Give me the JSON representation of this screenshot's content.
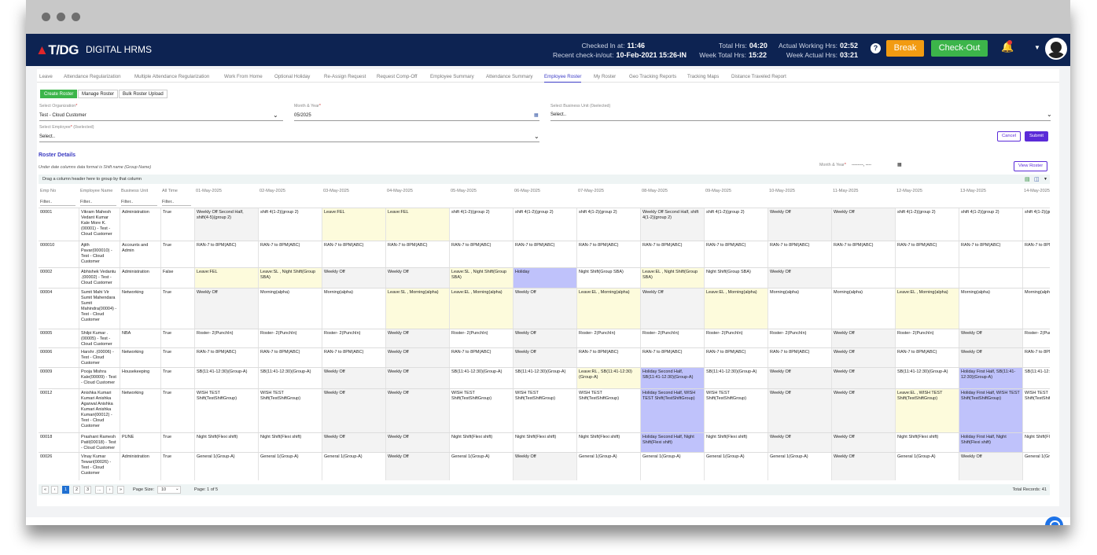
{
  "app": {
    "logo": "T/DG",
    "name": "DIGITAL HRMS"
  },
  "header": {
    "checked_in_label": "Checked In at:",
    "checked_in": "11:46",
    "recent_label": "Recent check-in/out:",
    "recent": "10-Feb-2021 15:26-IN",
    "total_hrs_label": "Total Hrs:",
    "total_hrs": "04:20",
    "week_total_label": "Week Total Hrs:",
    "week_total": "15:22",
    "actual_label": "Actual Working Hrs:",
    "actual": "02:52",
    "week_actual_label": "Week Actual Hrs:",
    "week_actual": "03:21",
    "break_btn": "Break",
    "checkout_btn": "Check-Out",
    "help": "?"
  },
  "tabs": [
    "Leave",
    "Attendance Regularization",
    "Multiple Attendance Regularization",
    "Work From Home",
    "Optional Holiday",
    "Re-Assign Request",
    "Request Comp-Off",
    "Employee Summary",
    "Attendance Summary",
    "Employee Roster",
    "My Roster",
    "Geo Tracking Reports",
    "Tracking Maps",
    "Distance Traveled Report"
  ],
  "active_tab": "Employee Roster",
  "sub_buttons": [
    "Create Roster",
    "Manage Roster",
    "Bulk Roster Upload"
  ],
  "form": {
    "org_label": "Select Organization",
    "org_value": "Test - Cloud Customer",
    "month_label": "Month & Year",
    "month_value": "05/2025",
    "bu_label": "Select Business Unit",
    "bu_sel": "(0selected)",
    "bu_value": "Select..",
    "emp_label": "Select Employee",
    "emp_sel": "(0selected)",
    "emp_value": "Select..",
    "cancel": "Cancel",
    "submit": "Submit"
  },
  "roster": {
    "title": "Roster Details",
    "note": "Under date columns data format is Shift name (Group Name)",
    "month_label": "Month & Year",
    "month_value": "--------, ----",
    "view_btn": "View Roster",
    "group_hint": "Drag a column header here to group by that column",
    "filter": "Filter..",
    "columns": [
      "Emp No",
      "Employee Name",
      "Business Unit",
      "All Time",
      "01-May-2025",
      "02-May-2025",
      "03-May-2025",
      "04-May-2025",
      "05-May-2025",
      "06-May-2025",
      "07-May-2025",
      "08-May-2025",
      "09-May-2025",
      "10-May-2025",
      "11-May-2025",
      "12-May-2025",
      "13-May-2025",
      "14-May-2025"
    ],
    "rows": [
      {
        "no": "00001",
        "name": "Vikram Mahesh Vedant Kumar Kale More K.(00001) - Test - Cloud Customer",
        "bu": "Administration",
        "all": "True",
        "cells": [
          "Weekly Off Second Half, shift(4-5)(group 2)",
          "shift 4(1-2)(group 2)",
          "Leave:FEL",
          "Leave:FEL",
          "shift 4(1-2)(group 2)",
          "shift 4(1-2)(group 2)",
          "shift 4(1-2)(group 2)",
          "Weekly Off Second Half, shift 4(1-2)(group 2)",
          "shift 4(1-2)(group 2)",
          "Weekly Off",
          "Weekly Off",
          "shift 4(1-2)(group 2)",
          "shift 4(1-2)(group 2)",
          "shift 4(1-2)(group 2)"
        ],
        "bg": [
          "g",
          "w",
          "y",
          "y",
          "w",
          "w",
          "w",
          "g",
          "w",
          "g",
          "g",
          "w",
          "w",
          "w"
        ]
      },
      {
        "no": "000010",
        "name": "Ajith Pavar(000010) - Test - Cloud Customer",
        "bu": "Accounts and Admin",
        "all": "True",
        "cells": [
          "RAN-7 to 8PM(ABC)",
          "RAN-7 to 8PM(ABC)",
          "RAN-7 to 8PM(ABC)",
          "RAN-7 to 8PM(ABC)",
          "RAN-7 to 8PM(ABC)",
          "RAN-7 to 8PM(ABC)",
          "RAN-7 to 8PM(ABC)",
          "RAN-7 to 8PM(ABC)",
          "RAN-7 to 8PM(ABC)",
          "RAN-7 to 8PM(ABC)",
          "RAN-7 to 8PM(ABC)",
          "RAN-7 to 8PM(ABC)",
          "RAN-7 to 8PM(ABC)",
          "RAN-7 to 8PM(ABC)"
        ],
        "bg": [
          "w",
          "w",
          "w",
          "w",
          "w",
          "w",
          "w",
          "w",
          "w",
          "w",
          "w",
          "w",
          "w",
          "w"
        ]
      },
      {
        "no": "00002",
        "name": "Abhishek Vedantu .(00002) - Test - Cloud Customer",
        "bu": "Administration",
        "all": "False",
        "cells": [
          "Leave:FEL",
          "Leave:SL , Night Shift(Group SBA)",
          "Weekly Off",
          "Weekly Off",
          "Leave:SL , Night Shift(Group SBA)",
          "Holiday",
          "Night Shift(Group SBA)",
          "Leave:EL , Night Shift(Group SBA)",
          "Night Shift(Group SBA)",
          "Weekly Off",
          "",
          "",
          "",
          ""
        ],
        "bg": [
          "y",
          "y",
          "g",
          "g",
          "y",
          "p",
          "w",
          "y",
          "w",
          "g",
          "w",
          "w",
          "w",
          "w"
        ]
      },
      {
        "no": "00004",
        "name": "Sumit Mahi Vir Sumit Mahendara Sumit Mahindra(00004) - Test - Cloud Customer",
        "bu": "Networking",
        "all": "True",
        "cells": [
          "Weekly Off",
          "Morning(alpha)",
          "Morning(alpha)",
          "Leave:SL , Morning(alpha)",
          "Leave:EL , Morning(alpha)",
          "Weekly Off",
          "Leave:EL , Morning(alpha)",
          "Weekly Off",
          "Leave:EL , Morning(alpha)",
          "Morning(alpha)",
          "Morning(alpha)",
          "Leave:EL , Morning(alpha)",
          "Morning(alpha)",
          "Morning(alpha)"
        ],
        "bg": [
          "g",
          "w",
          "w",
          "y",
          "y",
          "g",
          "y",
          "g",
          "y",
          "w",
          "w",
          "y",
          "w",
          "w"
        ]
      },
      {
        "no": "00005",
        "name": "Shilpi Kumar .(00005) - Test - Cloud Customer",
        "bu": "NBA",
        "all": "True",
        "cells": [
          "Roster- 2(PunchIn)",
          "Roster- 2(PunchIn)",
          "Roster- 2(PunchIn)",
          "Weekly Off",
          "Roster- 2(PunchIn)",
          "Weekly Off",
          "Roster- 2(PunchIn)",
          "Roster- 2(PunchIn)",
          "Roster- 2(PunchIn)",
          "Roster- 2(PunchIn)",
          "Weekly Off",
          "Roster- 2(PunchIn)",
          "Weekly Off",
          "Roster- 2(PunchIn)"
        ],
        "bg": [
          "w",
          "w",
          "w",
          "g",
          "w",
          "g",
          "w",
          "w",
          "w",
          "w",
          "g",
          "w",
          "g",
          "w"
        ]
      },
      {
        "no": "00006",
        "name": "Harshr .(00006) - Test - Cloud Customer",
        "bu": "Networking",
        "all": "True",
        "cells": [
          "RAN-7 to 8PM(ABC)",
          "RAN-7 to 8PM(ABC)",
          "RAN-7 to 8PM(ABC)",
          "Weekly Off",
          "RAN-7 to 8PM(ABC)",
          "Weekly Off",
          "RAN-7 to 8PM(ABC)",
          "RAN-7 to 8PM(ABC)",
          "RAN-7 to 8PM(ABC)",
          "RAN-7 to 8PM(ABC)",
          "Weekly Off",
          "RAN-7 to 8PM(ABC)",
          "Weekly Off",
          "RAN-7 to 8PM(ABC)"
        ],
        "bg": [
          "w",
          "w",
          "w",
          "g",
          "w",
          "g",
          "w",
          "w",
          "w",
          "w",
          "g",
          "w",
          "g",
          "w"
        ]
      },
      {
        "no": "00009",
        "name": "Pooja Mishra Kale(00009) - Test - Cloud Customer",
        "bu": "Housekeeping",
        "all": "True",
        "cells": [
          "SB(11:41-12:30)(Group-A)",
          "SB(11:41-12:30)(Group-A)",
          "Weekly Off",
          "Weekly Off",
          "SB(11:41-12:30)(Group-A)",
          "SB(11:41-12:30)(Group-A)",
          "Leave:RL , SB(11:41-12:30)(Group-A)",
          "Holiday Second Half, SB(11:41-12:30)(Group-A)",
          "SB(11:41-12:30)(Group-A)",
          "Weekly Off",
          "Weekly Off",
          "SB(11:41-12:30)(Group-A)",
          "Holiday First Half, SB(11:41-12:30)(Group-A)",
          "SB(11:41-12:30)(Group-A)"
        ],
        "bg": [
          "w",
          "w",
          "g",
          "g",
          "w",
          "w",
          "y",
          "p",
          "w",
          "g",
          "g",
          "w",
          "p",
          "w"
        ]
      },
      {
        "no": "00012",
        "name": "Anishka Kumari Kumari Anishka Agarwal Anishka Kumari Anishka Kumari(00012) - Test - Cloud Customer",
        "bu": "Networking",
        "all": "True",
        "cells": [
          "WISH TEST Shift(TestShiftGroup)",
          "WISH TEST Shift(TestShiftGroup)",
          "Weekly Off",
          "Weekly Off",
          "WISH TEST Shift(TestShiftGroup)",
          "WISH TEST Shift(TestShiftGroup)",
          "WISH TEST Shift(TestShiftGroup)",
          "Holiday Second Half, WISH TEST Shift(TestShiftGroup)",
          "WISH TEST Shift(TestShiftGroup)",
          "Weekly Off",
          "Weekly Off",
          "Leave:EL , WISH TEST Shift(TestShiftGroup)",
          "Holiday First Half, WISH TEST Shift(TestShiftGroup)",
          "WISH TEST Shift(TestShiftGroup)"
        ],
        "bg": [
          "w",
          "w",
          "g",
          "g",
          "w",
          "w",
          "w",
          "p",
          "w",
          "g",
          "g",
          "y",
          "p",
          "w"
        ]
      },
      {
        "no": "00018",
        "name": "Prashant Ramesh Patil(00018) - Test - Cloud Customer",
        "bu": "PUNE",
        "all": "True",
        "cells": [
          "Night Shift(Flexi shift)",
          "Night Shift(Flexi shift)",
          "Weekly Off",
          "Weekly Off",
          "Night Shift(Flexi shift)",
          "Night Shift(Flexi shift)",
          "Night Shift(Flexi shift)",
          "Holiday Second Half, Night Shift(Flexi shift)",
          "Night Shift(Flexi shift)",
          "Weekly Off",
          "Weekly Off",
          "Night Shift(Flexi shift)",
          "Holiday First Half, Night Shift(Flexi shift)",
          "Night Shift(Flexi shift)"
        ],
        "bg": [
          "w",
          "w",
          "g",
          "g",
          "w",
          "w",
          "w",
          "p",
          "w",
          "g",
          "g",
          "w",
          "p",
          "w"
        ]
      },
      {
        "no": "00026",
        "name": "Vinay Kumar Tewari(00026) - Test - Cloud Customer",
        "bu": "Administration",
        "all": "True",
        "cells": [
          "General 1(Group-A)",
          "General 1(Group-A)",
          "General 1(Group-A)",
          "Weekly Off",
          "General 1(Group-A)",
          "Weekly Off",
          "General 1(Group-A)",
          "General 1(Group-A)",
          "General 1(Group-A)",
          "General 1(Group-A)",
          "Weekly Off",
          "General 1(Group-A)",
          "Weekly Off",
          "General 1(Group-A)"
        ],
        "bg": [
          "w",
          "w",
          "w",
          "g",
          "w",
          "g",
          "w",
          "w",
          "w",
          "w",
          "g",
          "w",
          "g",
          "w"
        ]
      }
    ]
  },
  "pager": {
    "pages": [
      "«",
      "‹",
      "1",
      "2",
      "3",
      "...",
      "›",
      "»"
    ],
    "active": "1",
    "size_label": "Page Size:",
    "size": "10",
    "page_info": "Page: 1 of 5",
    "total": "Total Records: 41"
  }
}
